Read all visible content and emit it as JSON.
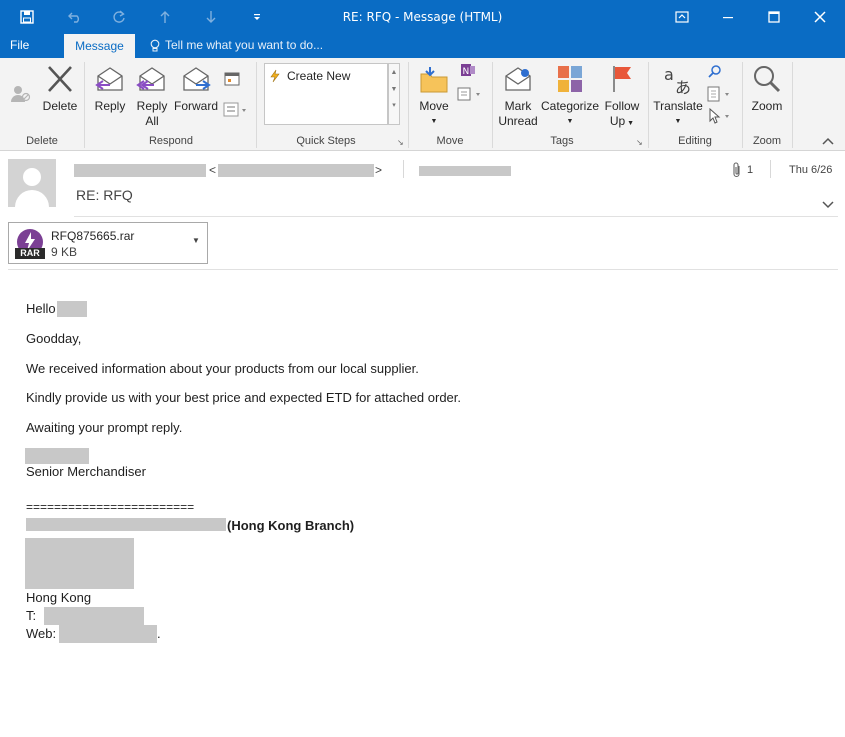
{
  "window": {
    "title": "RE: RFQ  -  Message (HTML)"
  },
  "tabs": {
    "file": "File",
    "message": "Message",
    "tell_me": "Tell me what you want to do..."
  },
  "ribbon": {
    "delete_group": {
      "label": "Delete",
      "delete": "Delete"
    },
    "respond_group": {
      "label": "Respond",
      "reply": "Reply",
      "reply_all_1": "Reply",
      "reply_all_2": "All",
      "forward": "Forward"
    },
    "quick_steps": {
      "label": "Quick Steps",
      "create_new": "Create New"
    },
    "move_group": {
      "label": "Move",
      "move": "Move"
    },
    "tags_group": {
      "label": "Tags",
      "mark_unread_1": "Mark",
      "mark_unread_2": "Unread",
      "categorize": "Categorize",
      "follow_up_1": "Follow",
      "follow_up_2": "Up"
    },
    "editing_group": {
      "label": "Editing",
      "translate": "Translate"
    },
    "zoom_group": {
      "label": "Zoom",
      "zoom": "Zoom"
    }
  },
  "message": {
    "sender_lt": "<",
    "sender_gt": ">",
    "attachment_count": "1",
    "date": "Thu 6/26",
    "subject": "RE: RFQ"
  },
  "attachment": {
    "name": "RFQ875665.rar",
    "size": "9 KB",
    "badge": "RAR"
  },
  "body": {
    "greeting": "Hello",
    "goodday": "Goodday,",
    "line1": "We received information about your products from our local supplier.",
    "line2": "Kindly provide us with your best price and expected ETD for attached order.",
    "line3": "Awaiting your prompt reply.",
    "role": "Senior Merchandiser",
    "divider": "========================",
    "branch": "(Hong Kong Branch)",
    "city": "Hong Kong",
    "tel_label": "T:",
    "web_label": "Web:",
    "web_end": "."
  },
  "colors": {
    "titlebar": "#0a6cc4",
    "ribbon": "#f3f3f3",
    "redaction": "#c8c8c8",
    "rar_badge": "#7b3f94"
  }
}
